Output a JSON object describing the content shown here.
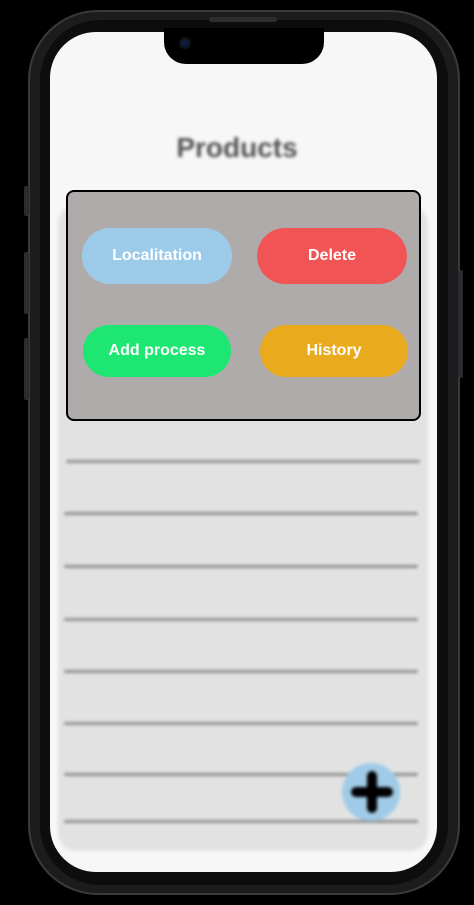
{
  "screen": {
    "title": "Products",
    "fab_icon": "plus-icon"
  },
  "modal": {
    "buttons": [
      {
        "label": "Localitation",
        "color": "#9ccbe9"
      },
      {
        "label": "Delete",
        "color": "#f05454"
      },
      {
        "label": "Add process",
        "color": "#1de673"
      },
      {
        "label": "History",
        "color": "#e9ab1d"
      }
    ]
  }
}
